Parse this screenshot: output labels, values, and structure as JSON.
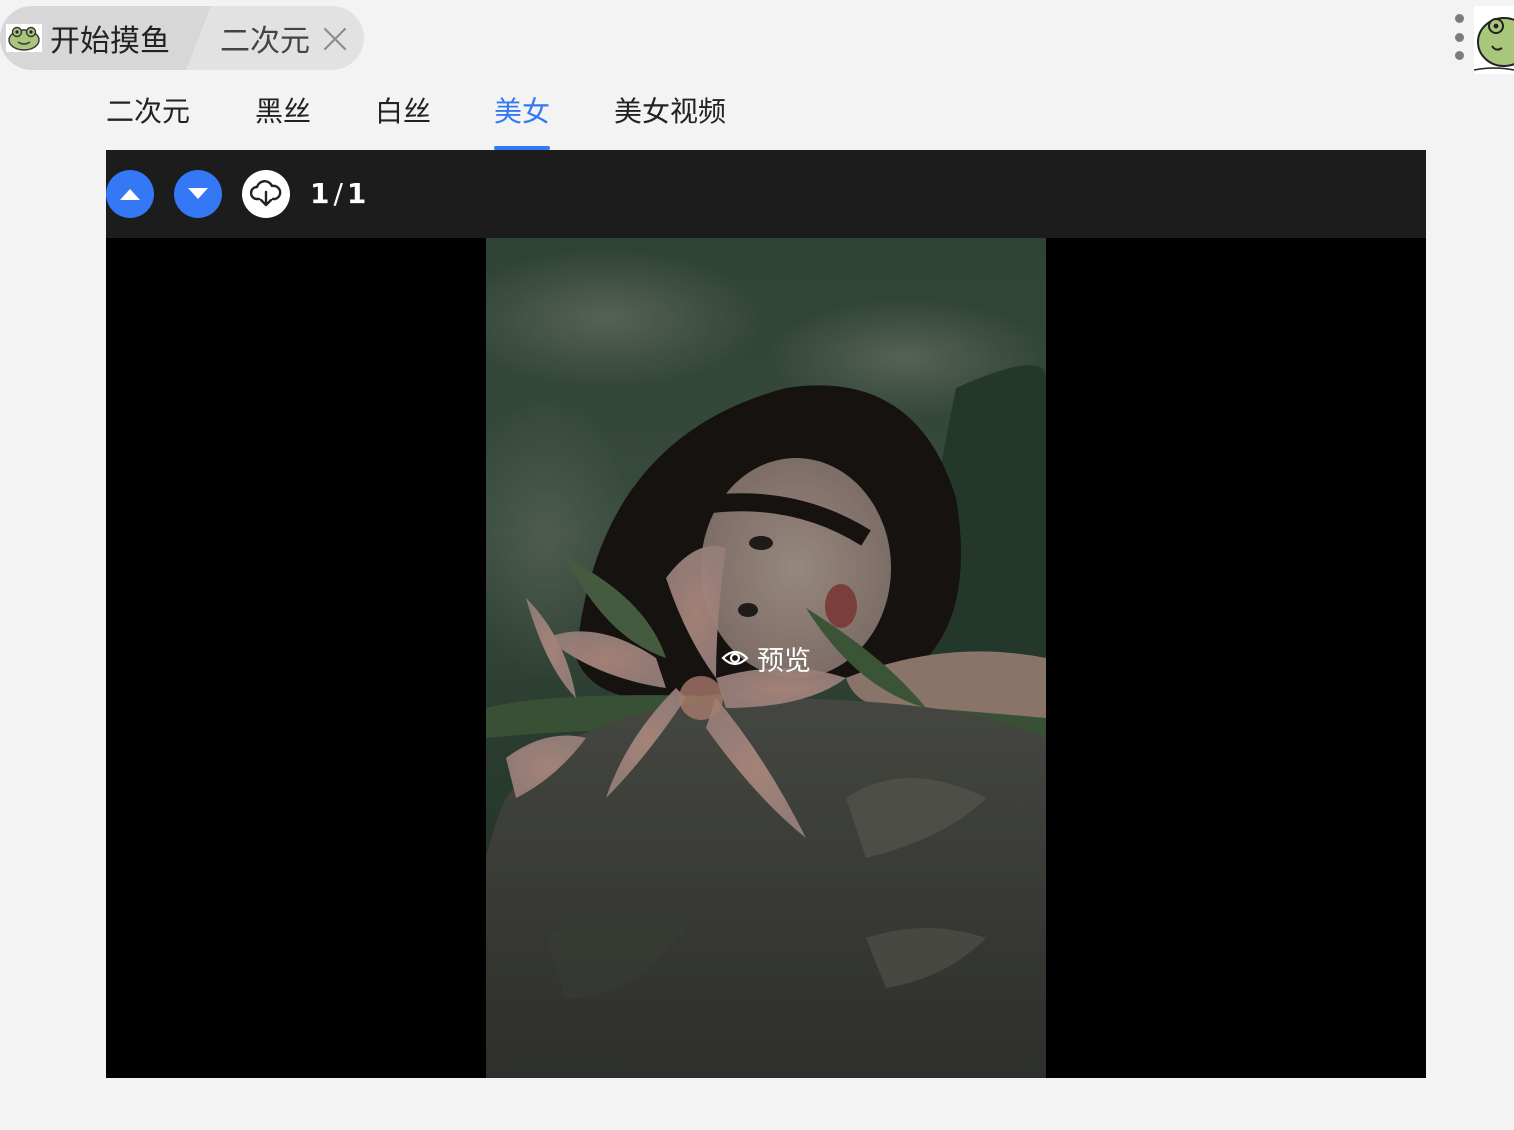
{
  "tabs": {
    "home_label": "开始摸鱼",
    "current_label": "二次元",
    "logo_icon": "frog-logo-icon",
    "close_icon": "close-icon"
  },
  "topbar": {
    "menu_icon": "more-vertical-icon",
    "avatar_icon": "frog-avatar-icon"
  },
  "categories": {
    "items": [
      "二次元",
      "黑丝",
      "白丝",
      "美女",
      "美女视频"
    ],
    "active": "美女"
  },
  "viewer": {
    "prev_icon": "arrow-up-icon",
    "next_icon": "arrow-down-icon",
    "download_icon": "cloud-download-icon",
    "current": "1",
    "total": "1",
    "preview_label": "预览",
    "preview_icon": "eye-icon"
  },
  "colors": {
    "accent": "#3478f6",
    "toolbar_bg": "#1c1c1c",
    "page_bg": "#f3f3f3"
  }
}
